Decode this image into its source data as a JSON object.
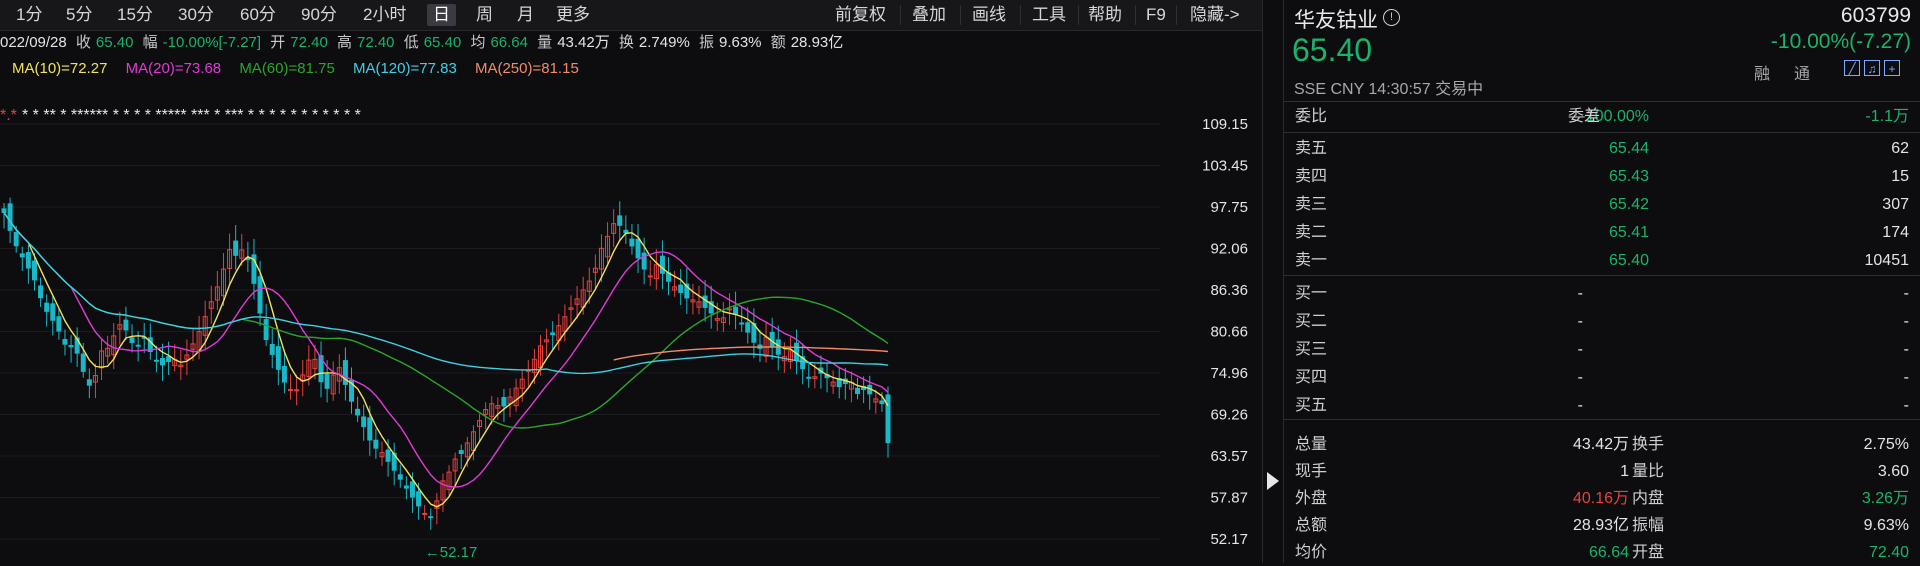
{
  "toolbar": {
    "periods": [
      "1分",
      "5分",
      "15分",
      "30分",
      "60分",
      "90分",
      "2小时",
      "日",
      "周",
      "月",
      "更多"
    ],
    "active_period": "日",
    "tools": [
      "前复权",
      "叠加",
      "画线",
      "工具",
      "帮助",
      "F9",
      "隐藏->"
    ]
  },
  "info": {
    "date": "022/09/28",
    "close_label": "收",
    "close": "65.40",
    "range_label": "幅",
    "range": "-10.00%[-7.27]",
    "open_label": "开",
    "open": "72.40",
    "high_label": "高",
    "high": "72.40",
    "low_label": "低",
    "low": "65.40",
    "avg_label": "均",
    "avg": "66.64",
    "vol_label": "量",
    "vol": "43.42万",
    "turnover_label": "换",
    "turnover": "2.749%",
    "amp_label": "振",
    "amp": "9.63%",
    "amount_label": "额",
    "amount": "28.93亿"
  },
  "ma": {
    "ma10": "MA(10)=72.27",
    "ma20": "MA(20)=73.68",
    "ma60": "MA(60)=81.75",
    "ma120": "MA(120)=77.83",
    "ma250": "MA(250)=81.15"
  },
  "colors": {
    "up": "#e8413d",
    "down": "#19b8c8",
    "ma10": "#f2e25a",
    "ma20": "#e03ad6",
    "ma60": "#2aa52a",
    "ma120": "#3fd0e6",
    "ma250": "#f08c6a"
  },
  "chart_data": {
    "type": "candlestick",
    "y_ticks": [
      "109.15",
      "103.45",
      "97.75",
      "92.06",
      "86.36",
      "80.66",
      "74.96",
      "69.26",
      "63.57",
      "57.87",
      "52.17"
    ],
    "ylim": [
      52.17,
      109.15
    ],
    "low_marker": "←52.17",
    "marker_row": "* * ** * ****** * * * * ***** *** * *** * * * * * * * * * * *",
    "clipped_marker": "*.*",
    "last_close": 65.4
  },
  "quote": {
    "name": "华友钴业",
    "code": "603799",
    "price": "65.40",
    "change": "-10.00%(-7.27)",
    "sub": "SSE  CNY  14:30:57  交易中",
    "rong": "融",
    "tong": "通",
    "weibi_label": "委比",
    "weibi": "-100.00%",
    "weicha_label": "委差",
    "weicha": "-1.1万",
    "asks": [
      {
        "label": "卖五",
        "price": "65.44",
        "vol": "62"
      },
      {
        "label": "卖四",
        "price": "65.43",
        "vol": "15"
      },
      {
        "label": "卖三",
        "price": "65.42",
        "vol": "307"
      },
      {
        "label": "卖二",
        "price": "65.41",
        "vol": "174"
      },
      {
        "label": "卖一",
        "price": "65.40",
        "vol": "10451"
      }
    ],
    "bids": [
      {
        "label": "买一",
        "price": "-",
        "vol": "-"
      },
      {
        "label": "买二",
        "price": "-",
        "vol": "-"
      },
      {
        "label": "买三",
        "price": "-",
        "vol": "-"
      },
      {
        "label": "买四",
        "price": "-",
        "vol": "-"
      },
      {
        "label": "买五",
        "price": "-",
        "vol": "-"
      }
    ],
    "stats": [
      {
        "l1": "总量",
        "v1": "43.42万",
        "c1": "white",
        "l2": "换手",
        "v2": "2.75%",
        "c2": "white"
      },
      {
        "l1": "现手",
        "v1": "1",
        "c1": "white",
        "l2": "量比",
        "v2": "3.60",
        "c2": "white"
      },
      {
        "l1": "外盘",
        "v1": "40.16万",
        "c1": "red",
        "l2": "内盘",
        "v2": "3.26万",
        "c2": "green"
      },
      {
        "l1": "总额",
        "v1": "28.93亿",
        "c1": "white",
        "l2": "振幅",
        "v2": "9.63%",
        "c2": "white"
      },
      {
        "l1": "均价",
        "v1": "66.64",
        "c1": "green",
        "l2": "开盘",
        "v2": "72.40",
        "c2": "green"
      }
    ]
  }
}
